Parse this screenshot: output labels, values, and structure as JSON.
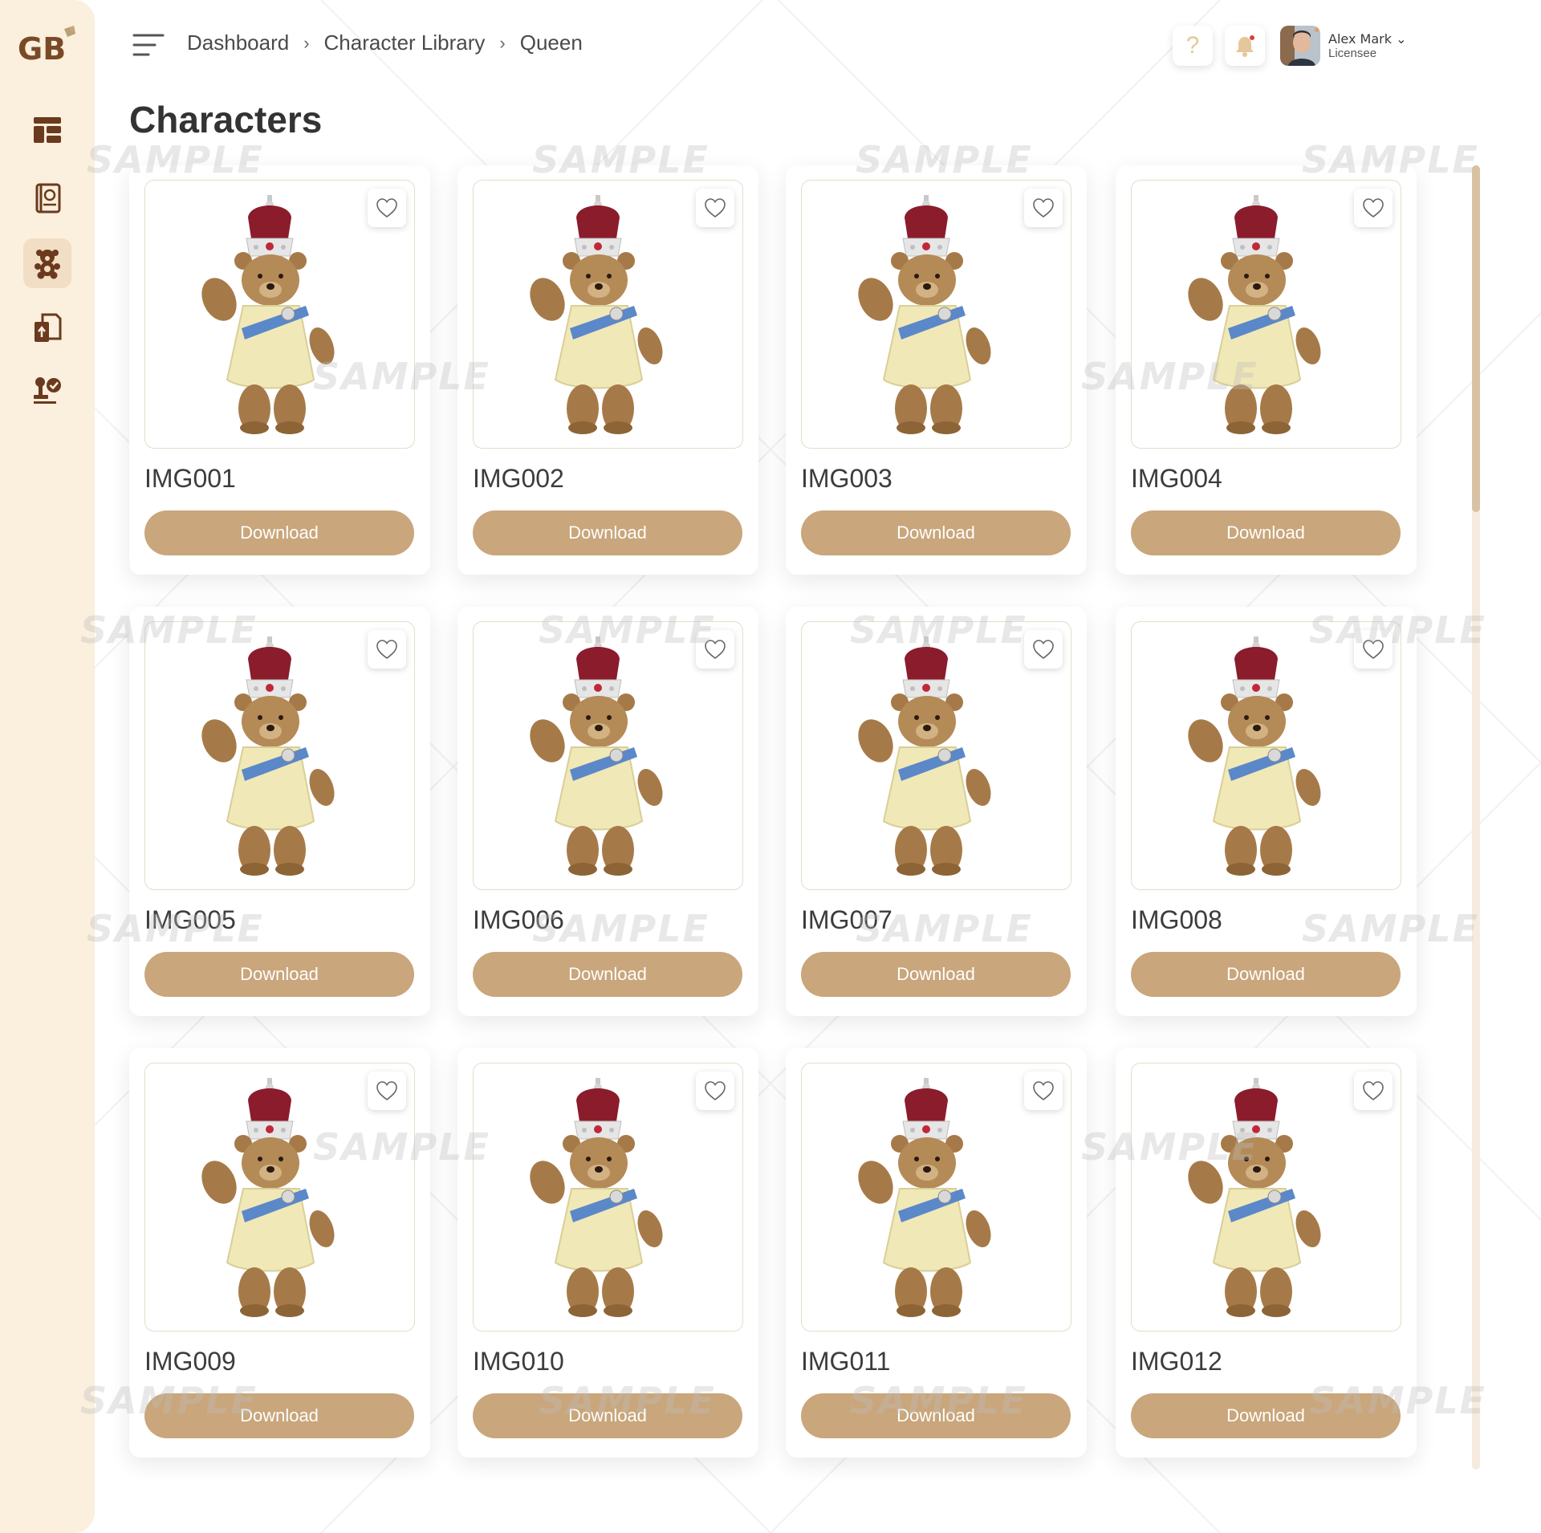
{
  "app": {
    "logo_text": "GB"
  },
  "sidebar": {
    "items": [
      {
        "name": "dashboard",
        "icon": "layout-icon"
      },
      {
        "name": "style-guide",
        "icon": "book-icon"
      },
      {
        "name": "characters",
        "icon": "teddy-bear-icon",
        "active": true
      },
      {
        "name": "uploads",
        "icon": "file-upload-icon"
      },
      {
        "name": "approvals",
        "icon": "approval-stamp-icon"
      }
    ]
  },
  "header": {
    "breadcrumb": [
      "Dashboard",
      "Character Library",
      "Queen"
    ],
    "help_label": "?",
    "user": {
      "name": "Alex Mark",
      "role": "Licensee"
    }
  },
  "page": {
    "title": "Characters"
  },
  "watermark": "SAMPLE",
  "cards": [
    {
      "id": "IMG001",
      "button": "Download"
    },
    {
      "id": "IMG002",
      "button": "Download"
    },
    {
      "id": "IMG003",
      "button": "Download"
    },
    {
      "id": "IMG004",
      "button": "Download"
    },
    {
      "id": "IMG005",
      "button": "Download"
    },
    {
      "id": "IMG006",
      "button": "Download"
    },
    {
      "id": "IMG007",
      "button": "Download"
    },
    {
      "id": "IMG008",
      "button": "Download"
    },
    {
      "id": "IMG009",
      "button": "Download"
    },
    {
      "id": "IMG010",
      "button": "Download"
    },
    {
      "id": "IMG011",
      "button": "Download"
    },
    {
      "id": "IMG012",
      "button": "Download"
    }
  ],
  "colors": {
    "accent": "#c9a67b",
    "sidebar_bg": "#fbefdd",
    "icon_brown": "#6b3a1e"
  }
}
